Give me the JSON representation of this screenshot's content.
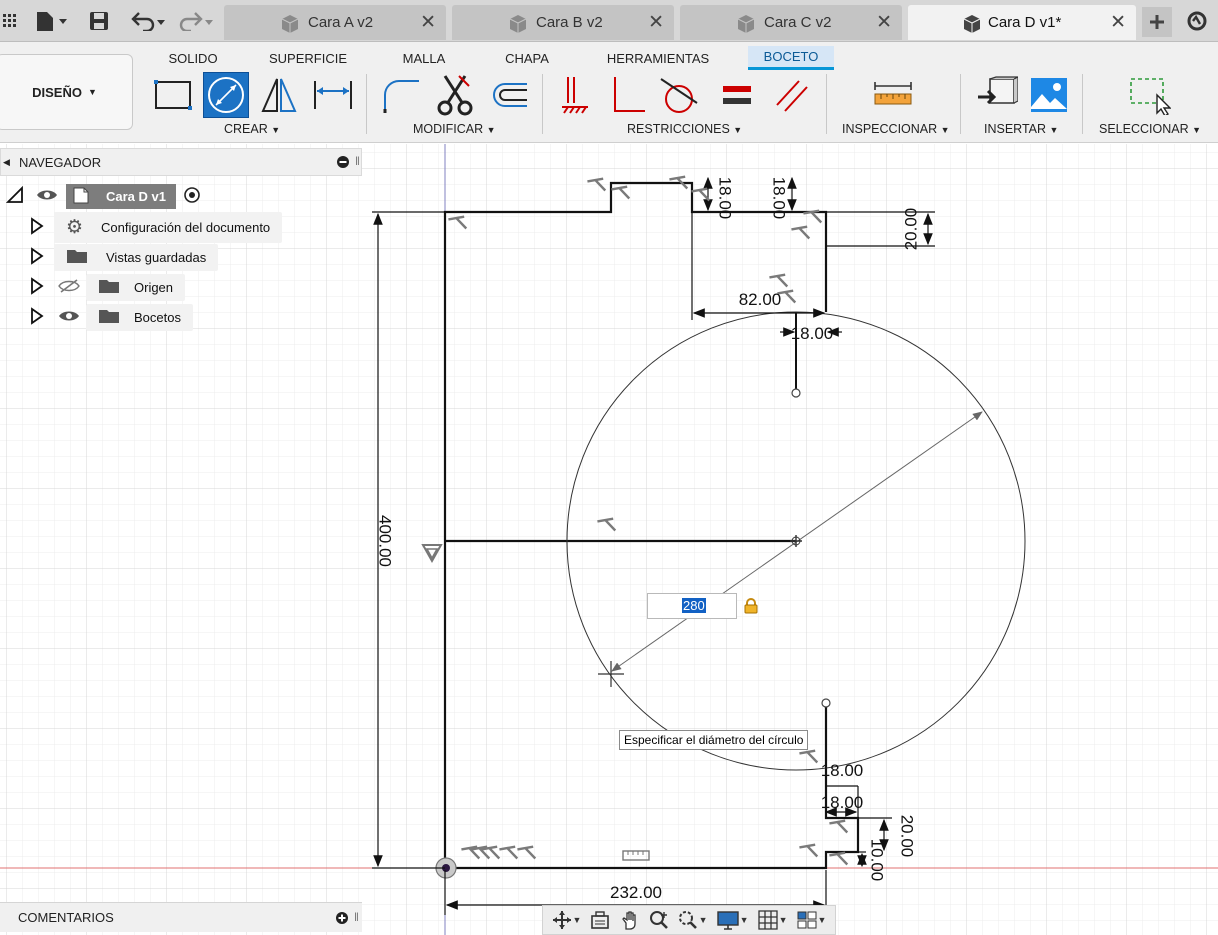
{
  "colors": {
    "accent": "#0696d7",
    "selected_tool": "#1c72c4",
    "constraint_red": "#c00000",
    "axis_red": "#e07070"
  },
  "doc_tabs": [
    {
      "label": "Cara A v2",
      "active": false
    },
    {
      "label": "Cara B v2",
      "active": false
    },
    {
      "label": "Cara C v2",
      "active": false
    },
    {
      "label": "Cara D v1*",
      "active": true
    }
  ],
  "workspace": {
    "label": "DISEÑO"
  },
  "ribbon_tabs": [
    "SOLIDO",
    "SUPERFICIE",
    "MALLA",
    "CHAPA",
    "HERRAMIENTAS",
    "BOCETO"
  ],
  "groups": {
    "crear": "CREAR",
    "modificar": "MODIFICAR",
    "restricciones": "RESTRICCIONES",
    "inspeccionar": "INSPECCIONAR",
    "insertar": "INSERTAR",
    "seleccionar": "SELECCIONAR"
  },
  "navigator": {
    "title": "NAVEGADOR",
    "root": "Cara D v1",
    "items": [
      "Configuración del documento",
      "Vistas guardadas",
      "Origen",
      "Bocetos"
    ]
  },
  "comments": {
    "label": "COMENTARIOS"
  },
  "dimensions": {
    "d_400": "400.00",
    "d_232": "232.00",
    "d_82": "82.00",
    "d_18_a": "18.00",
    "d_18_top1": "18.00",
    "d_18_top2": "18.00",
    "d_20_top": "20.00",
    "d_18_b1": "18.00",
    "d_18_b2": "18.00",
    "d_20_b": "20.00",
    "d_10_b": "10.00"
  },
  "diameter_input": {
    "value": "280"
  },
  "tooltip": "Especificar el diámetro del círculo"
}
